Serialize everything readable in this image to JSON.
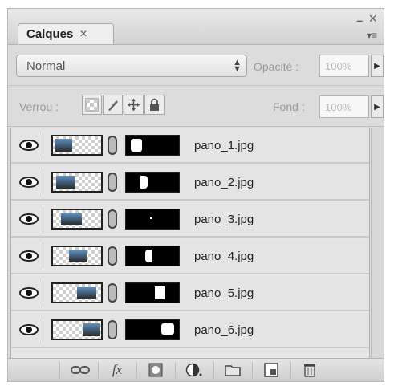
{
  "panel": {
    "tab_label": "Calques",
    "tab_close": "×",
    "window_minimize": "–",
    "window_close": "×",
    "panel_menu": "▾≡"
  },
  "controls": {
    "blend_mode": "Normal",
    "opacity_label": "Opacité :",
    "opacity_value": "100%",
    "lock_label": "Verrou :",
    "fill_label": "Fond :",
    "fill_value": "100%"
  },
  "layers": [
    {
      "name": "pano_1.jpg",
      "visible": true
    },
    {
      "name": "pano_2.jpg",
      "visible": true
    },
    {
      "name": "pano_3.jpg",
      "visible": true
    },
    {
      "name": "pano_4.jpg",
      "visible": true
    },
    {
      "name": "pano_5.jpg",
      "visible": true
    },
    {
      "name": "pano_6.jpg",
      "visible": true
    }
  ],
  "bottom_toolbar": {
    "fx_label": "fx"
  },
  "icons": [
    "link-layers-icon",
    "fx-icon",
    "add-mask-icon",
    "adjustment-layer-icon",
    "new-group-icon",
    "new-layer-icon",
    "trash-icon",
    "eye-icon",
    "chain-icon",
    "lock-transparent-icon",
    "lock-paint-icon",
    "lock-move-icon",
    "lock-all-icon"
  ]
}
